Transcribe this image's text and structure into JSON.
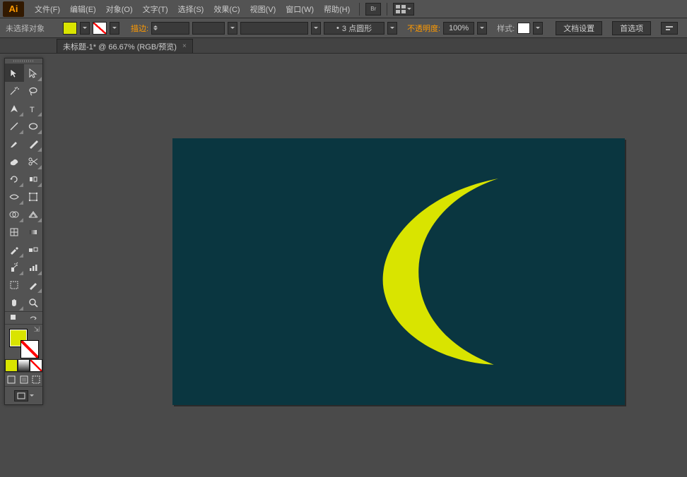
{
  "app": {
    "logo": "Ai"
  },
  "menu": {
    "file": "文件(F)",
    "edit": "编辑(E)",
    "object": "对象(O)",
    "type": "文字(T)",
    "select": "选择(S)",
    "effect": "效果(C)",
    "view": "视图(V)",
    "window": "窗口(W)",
    "help": "帮助(H)"
  },
  "control": {
    "selection": "未选择对象",
    "stroke_label": "描边:",
    "stroke_width": "",
    "stroke_style": "3 点圆形",
    "opacity_label": "不透明度:",
    "opacity_value": "100%",
    "style_label": "样式:",
    "doc_setup": "文档设置",
    "prefs": "首选项"
  },
  "tab": {
    "title": "未标题-1* @ 66.67% (RGB/预览)"
  },
  "colors": {
    "accent": "#d9e400",
    "canvas_bg": "#0a3640"
  }
}
